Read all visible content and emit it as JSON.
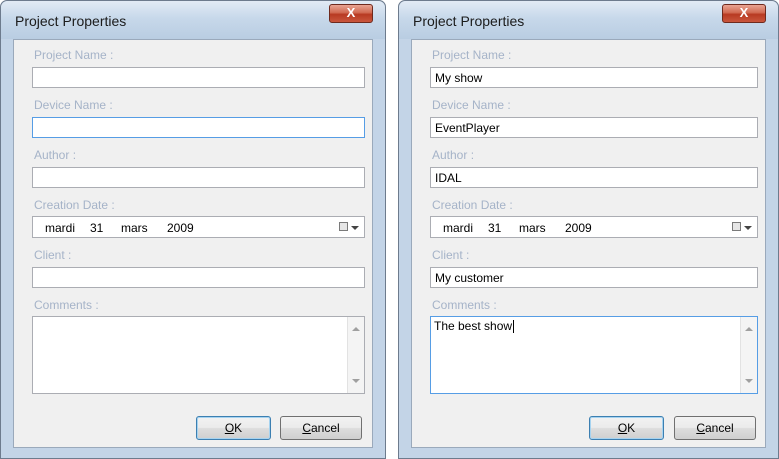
{
  "left": {
    "title": "Project Properties",
    "close_label": "X",
    "labels": {
      "project_name": "Project Name :",
      "device_name": "Device Name :",
      "author": "Author :",
      "creation_date": "Creation Date :",
      "client": "Client :",
      "comments": "Comments :"
    },
    "fields": {
      "project_name": "",
      "device_name": "",
      "author": "",
      "client": "",
      "comments": ""
    },
    "date": {
      "weekday": "mardi",
      "day": "31",
      "month": "mars",
      "year": "2009"
    },
    "buttons": {
      "ok_accel": "O",
      "ok_rest": "K",
      "cancel_accel": "C",
      "cancel_rest": "ancel"
    }
  },
  "right": {
    "title": "Project Properties",
    "close_label": "X",
    "labels": {
      "project_name": "Project Name :",
      "device_name": "Device Name :",
      "author": "Author :",
      "creation_date": "Creation Date :",
      "client": "Client :",
      "comments": "Comments :"
    },
    "fields": {
      "project_name": "My show",
      "device_name": "EventPlayer",
      "author": "IDAL",
      "client": "My customer",
      "comments": "The best show"
    },
    "date": {
      "weekday": "mardi",
      "day": "31",
      "month": "mars",
      "year": "2009"
    },
    "buttons": {
      "ok_accel": "O",
      "ok_rest": "K",
      "cancel_accel": "C",
      "cancel_rest": "ancel"
    }
  },
  "icons": {
    "close": "close-icon",
    "calendar": "calendar-icon",
    "dropdown": "chevron-down-icon",
    "scroll_up": "scroll-up-icon",
    "scroll_down": "scroll-down-icon"
  },
  "colors": {
    "title_bar": "#c7d8ea",
    "close_button": "#c9563d",
    "label_text": "#a5b3c8",
    "focus_border": "#569de5"
  }
}
